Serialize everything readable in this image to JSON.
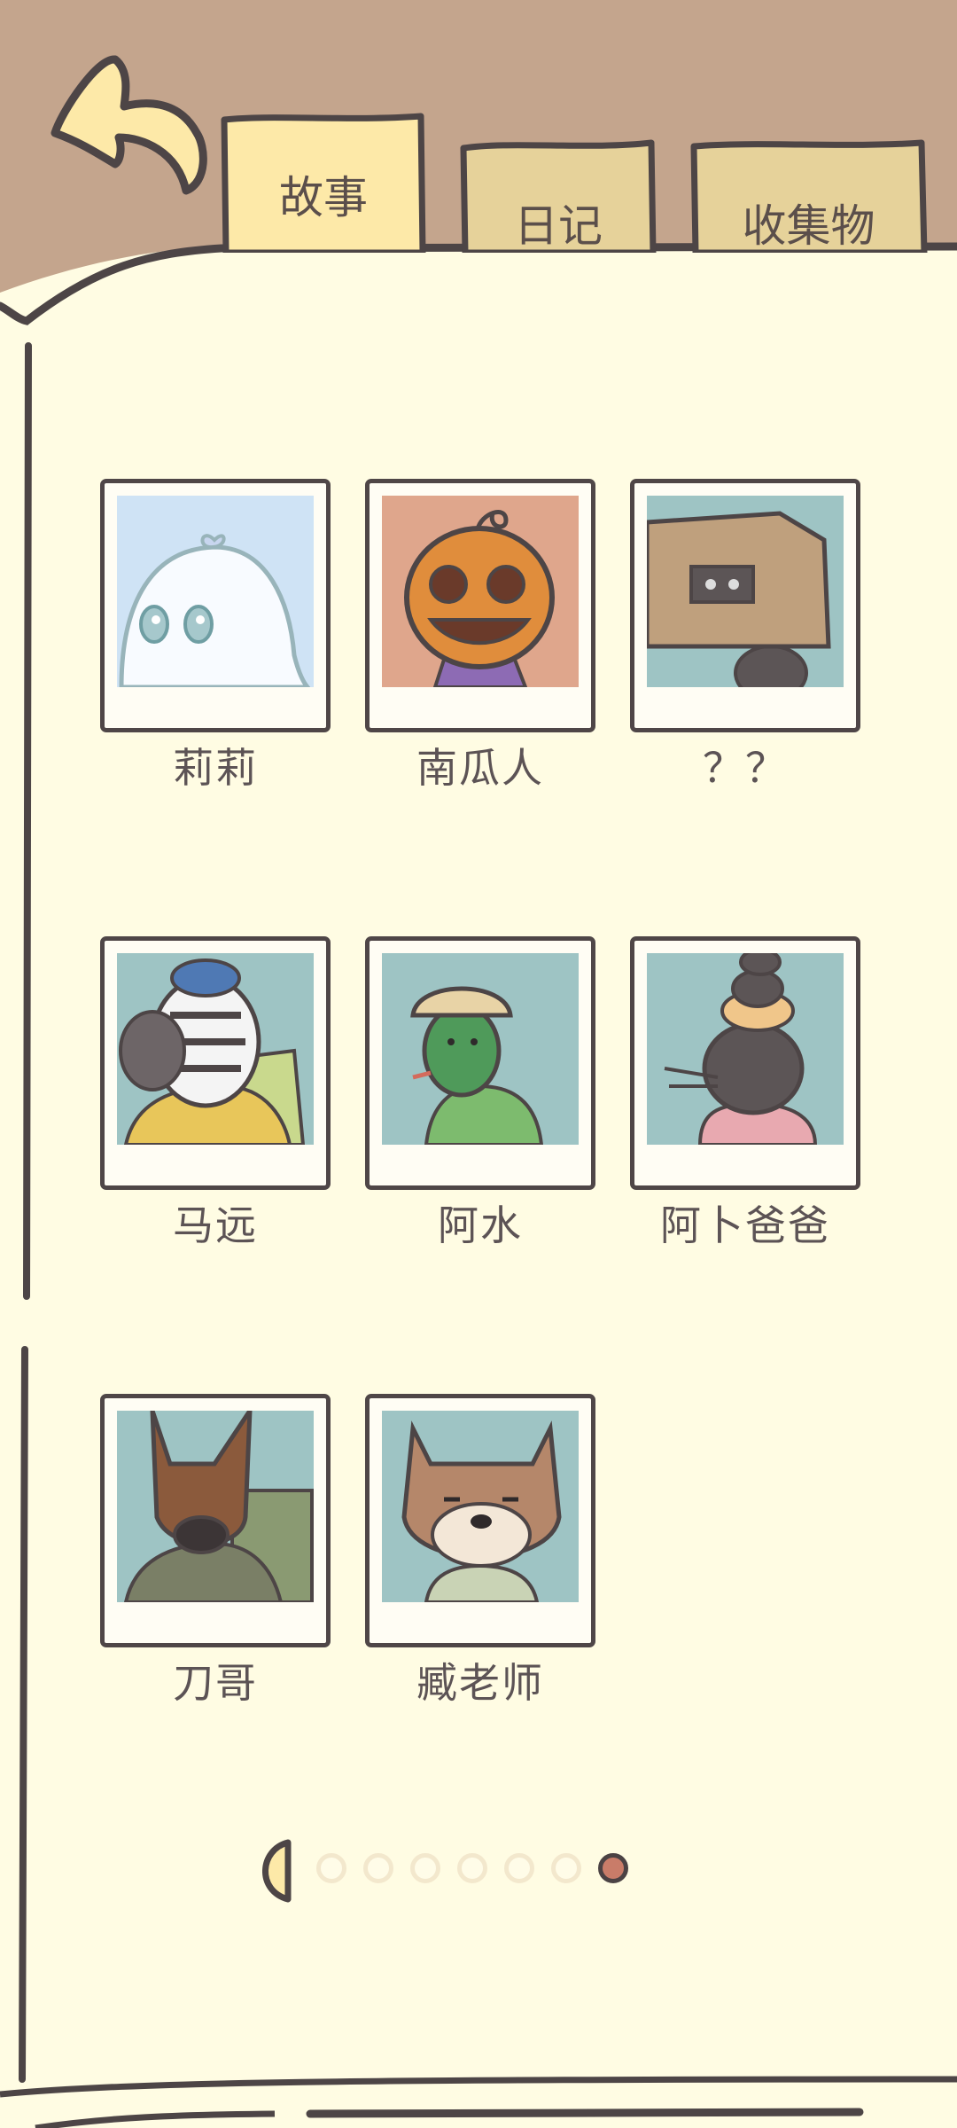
{
  "tabs": [
    {
      "label": "故事",
      "active": true
    },
    {
      "label": "日记",
      "active": false
    },
    {
      "label": "收集物",
      "active": false
    }
  ],
  "characters": [
    {
      "name": "莉莉",
      "icon": "ghost-lily-portrait"
    },
    {
      "name": "南瓜人",
      "icon": "pumpkin-man-portrait"
    },
    {
      "name": "？？",
      "icon": "box-mystery-portrait"
    },
    {
      "name": "马远",
      "icon": "zebra-mayuan-portrait"
    },
    {
      "name": "阿水",
      "icon": "frog-ashui-portrait"
    },
    {
      "name": "阿卜爸爸",
      "icon": "mole-father-portrait"
    },
    {
      "name": "刀哥",
      "icon": "doberman-daoge-portrait"
    },
    {
      "name": "臧老师",
      "icon": "shiba-teacher-portrait"
    }
  ],
  "pagination": {
    "total_pages": 7,
    "current_page": 7
  },
  "colors": {
    "frame": "#c4a58d",
    "paper": "#fffce3",
    "tab_active": "#fde9a8",
    "tab_inactive": "#e6d29a",
    "outline": "#4d4546",
    "active_dot": "#c97c69"
  }
}
